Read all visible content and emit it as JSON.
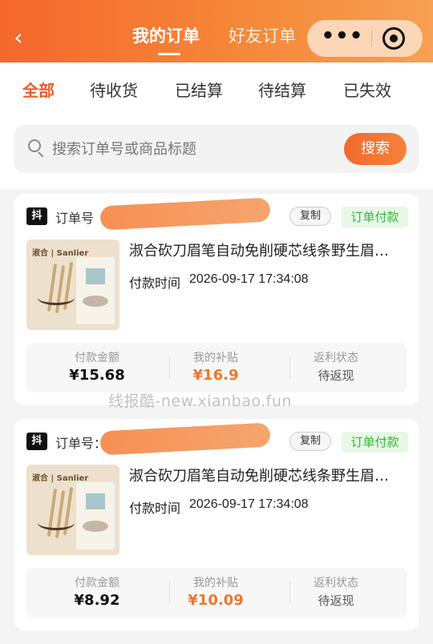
{
  "header": {
    "back_glyph": "‹",
    "tab_mine": "我的订单",
    "tab_friend": "好友订单",
    "more_icon": "more-dots-icon",
    "target_icon": "target-icon",
    "brand_color": "#f5672c"
  },
  "status_tabs": [
    "全部",
    "待收货",
    "已结算",
    "待结算",
    "已失效"
  ],
  "active_status_tab": "全部",
  "search": {
    "placeholder": "搜索订单号或商品标题",
    "button": "搜索"
  },
  "orders": [
    {
      "platform_badge": "抖",
      "order_label": "订单号",
      "copy": "复制",
      "status": "订单付款",
      "thumb_brand": "淑合 | Sanlier",
      "title": "淑合砍刀眉笔自动免削硬芯线条野生眉…",
      "pay_time_label": "付款时间",
      "pay_time": "2026-09-17 17:34:08",
      "amount_label": "付款金额",
      "amount": "¥15.68",
      "subsidy_label": "我的补贴",
      "subsidy": "¥16.9",
      "rebate_label": "返利状态",
      "rebate": "待返现"
    },
    {
      "platform_badge": "抖",
      "order_label": "订单号：",
      "copy": "复制",
      "status": "订单付款",
      "thumb_brand": "淑合 | Sanlier",
      "title": "淑合砍刀眉笔自动免削硬芯线条野生眉…",
      "pay_time_label": "付款时间",
      "pay_time": "2026-09-17 17:34:08",
      "amount_label": "付款金额",
      "amount": "¥8.92",
      "subsidy_label": "我的补贴",
      "subsidy": "¥10.09",
      "rebate_label": "返利状态",
      "rebate": "待返现"
    }
  ],
  "watermark": "线报酷-new.xianbao.fun"
}
